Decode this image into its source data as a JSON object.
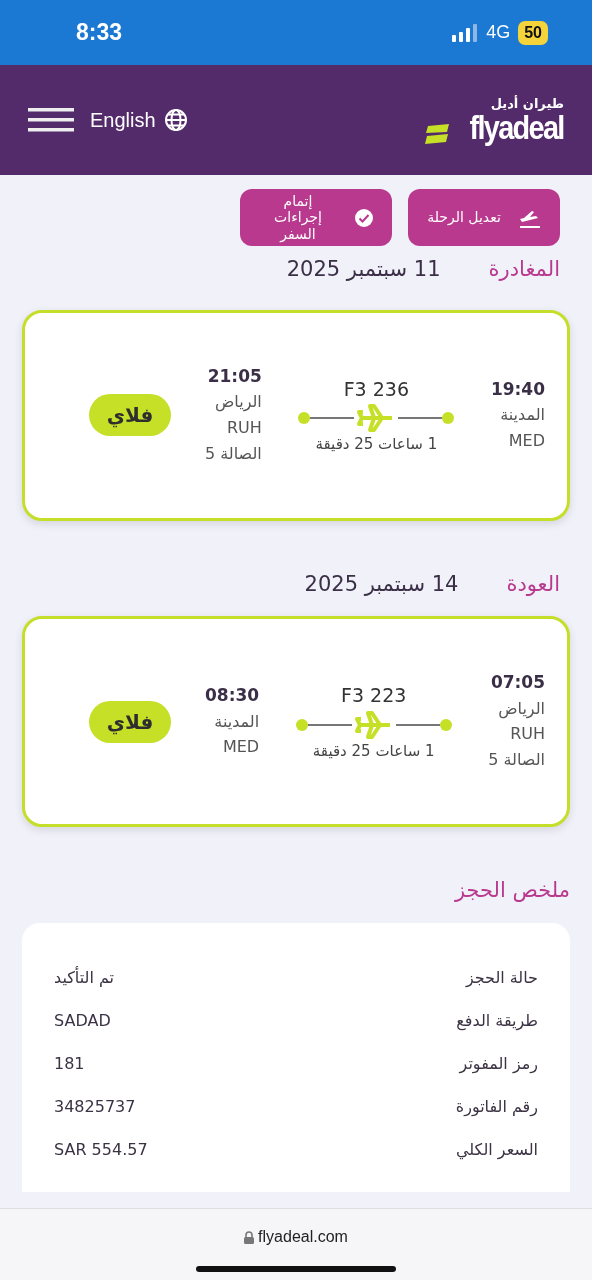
{
  "status_bar": {
    "time": "8:33",
    "network": "4G",
    "battery": "50"
  },
  "header": {
    "language": "English",
    "logo_arabic": "طيران أديل",
    "logo_text": "flyadeal"
  },
  "actions": [
    {
      "label": "تعديل الرحلة",
      "kind": "edit"
    },
    {
      "label": "إتمام إجراءات السفر",
      "kind": "checkin"
    }
  ],
  "flights": [
    {
      "heading": "المغادرة",
      "date": "11 سبتمبر 2025",
      "origin": {
        "time": "19:40",
        "city": "المدينة",
        "code": "MED"
      },
      "destination": {
        "time": "21:05",
        "city": "الرياض",
        "code": "RUH",
        "terminal": "الصالة 5"
      },
      "flight_number": "F3 236",
      "duration": "1 ساعات 25 دقيقة",
      "fare": "فلاي"
    },
    {
      "heading": "العودة",
      "date": "14 سبتمبر 2025",
      "origin": {
        "time": "07:05",
        "city": "الرياض",
        "code": "RUH",
        "terminal": "الصالة 5"
      },
      "destination": {
        "time": "08:30",
        "city": "المدينة",
        "code": "MED"
      },
      "flight_number": "F3 223",
      "duration": "1 ساعات 25 دقيقة",
      "fare": "فلاي"
    }
  ],
  "summary": {
    "title": "ملخص الحجز",
    "rows": [
      {
        "label": "حالة الحجز",
        "value": "تم التأكيد"
      },
      {
        "label": "طريقة الدفع",
        "value": "SADAD"
      },
      {
        "label": "رمز المفوتر",
        "value": "181"
      },
      {
        "label": "رقم الفاتورة",
        "value": "34825737"
      },
      {
        "label": "السعر الكلي",
        "value": "SAR 554.57"
      }
    ]
  },
  "browser": {
    "url": "flyadeal.com"
  }
}
